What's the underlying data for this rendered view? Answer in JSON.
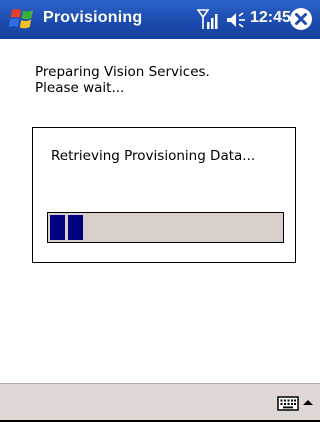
{
  "titlebar": {
    "app_title": "Provisioning",
    "clock": "12:45",
    "icons": {
      "start": "windows-flag-icon",
      "signal": "signal-strength-icon",
      "volume": "speaker-volume-icon",
      "close": "close-icon"
    }
  },
  "main": {
    "message": "Preparing Vision Services.\nPlease wait...",
    "status_text": "Retrieving Provisioning Data...",
    "progress_percent": 16
  },
  "menubar": {
    "icons": {
      "keyboard": "keyboard-icon",
      "arrow": "up-arrow-icon"
    }
  },
  "colors": {
    "titlebar": "#1c4cb0",
    "progress_fill": "#000080",
    "progress_track": "#d8cfcb",
    "menubar": "#e0d8d4"
  }
}
